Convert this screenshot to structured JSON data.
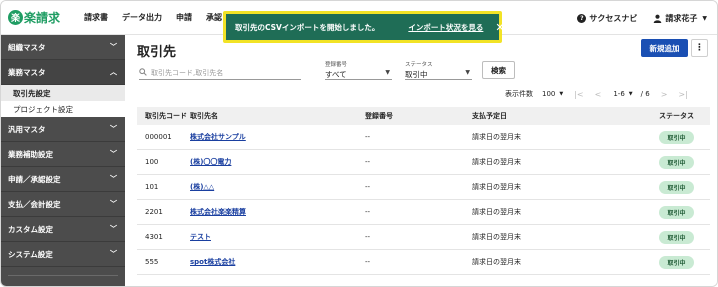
{
  "header": {
    "logo_mark": "楽",
    "logo_text": "楽請求",
    "nav": [
      "請求書",
      "データ出力",
      "申請",
      "承認"
    ],
    "help_label": "サクセスナビ",
    "user_name": "請求花子"
  },
  "toast": {
    "message": "取引先のCSVインポートを開始しました。",
    "link": "インポート状況を見る",
    "close": "✕"
  },
  "sidebar": {
    "sections": [
      {
        "label": "組織マスタ",
        "open": false
      },
      {
        "label": "業務マスタ",
        "open": true,
        "children": [
          "取引先設定",
          "プロジェクト設定"
        ]
      },
      {
        "label": "汎用マスタ",
        "open": false
      },
      {
        "label": "業務補助設定",
        "open": false
      },
      {
        "label": "申請／承認設定",
        "open": false
      },
      {
        "label": "支払／会計設定",
        "open": false
      },
      {
        "label": "カスタム設定",
        "open": false
      },
      {
        "label": "システム設定",
        "open": false
      }
    ]
  },
  "main": {
    "title": "取引先",
    "new_button": "新規追加",
    "more_button": "⋮",
    "search_placeholder": "取引先コード,取引先名",
    "filter_registration": {
      "label": "登録番号",
      "value": "すべて"
    },
    "filter_status": {
      "label": "ステータス",
      "value": "取引中"
    },
    "search_button": "検索",
    "pager": {
      "count_label": "表示件数",
      "count_value": "100",
      "range": "1-6",
      "total": "/ 6"
    }
  },
  "table": {
    "columns": [
      "取引先コード",
      "取引先名",
      "登録番号",
      "支払予定日",
      "ステータス"
    ],
    "rows": [
      {
        "code": "000001",
        "name": "株式会社サンプル",
        "reg": "--",
        "pay": "請求日の翌月末",
        "status": "取引中"
      },
      {
        "code": "100",
        "name": "(株)〇〇電力",
        "reg": "--",
        "pay": "請求日の翌月末",
        "status": "取引中"
      },
      {
        "code": "101",
        "name": "(株)△△",
        "reg": "--",
        "pay": "請求日の翌月末",
        "status": "取引中"
      },
      {
        "code": "2201",
        "name": "株式会社楽楽精算",
        "reg": "--",
        "pay": "請求日の翌月末",
        "status": "取引中"
      },
      {
        "code": "4301",
        "name": "テスト",
        "reg": "--",
        "pay": "請求日の翌月末",
        "status": "取引中"
      },
      {
        "code": "555",
        "name": "spot株式会社",
        "reg": "--",
        "pay": "請求日の翌月末",
        "status": "取引中"
      }
    ]
  },
  "colors": {
    "brand": "#1f9d63",
    "toast_bg": "#1f6d56",
    "toast_border": "#f2e326",
    "primary": "#1a4fb3",
    "sidebar": "#4c4c4c",
    "badge_bg": "#c9ead3"
  }
}
